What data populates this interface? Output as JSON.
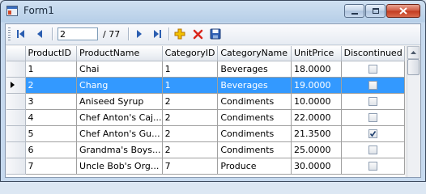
{
  "window": {
    "title": "Form1"
  },
  "navigator": {
    "position_value": "2",
    "count_label": "/ 77",
    "buttons": {
      "move_first": "first-record-icon",
      "move_previous": "previous-record-icon",
      "move_next": "next-record-icon",
      "move_last": "last-record-icon",
      "add_new": "add-icon",
      "delete": "delete-icon",
      "save": "save-icon"
    }
  },
  "grid": {
    "columns": [
      "ProductID",
      "ProductName",
      "CategoryID",
      "CategoryName",
      "UnitPrice",
      "Discontinued"
    ],
    "selected_row_index": 1,
    "rows": [
      {
        "cells": [
          "1",
          "Chai",
          "1",
          "Beverages",
          "18.0000"
        ],
        "discontinued": false
      },
      {
        "cells": [
          "2",
          "Chang",
          "1",
          "Beverages",
          "19.0000"
        ],
        "discontinued": false
      },
      {
        "cells": [
          "3",
          "Aniseed Syrup",
          "2",
          "Condiments",
          "10.0000"
        ],
        "discontinued": false
      },
      {
        "cells": [
          "4",
          "Chef Anton's Caj...",
          "2",
          "Condiments",
          "22.0000"
        ],
        "discontinued": false
      },
      {
        "cells": [
          "5",
          "Chef Anton's Gu...",
          "2",
          "Condiments",
          "21.3500"
        ],
        "discontinued": true
      },
      {
        "cells": [
          "6",
          "Grandma's Boys...",
          "2",
          "Condiments",
          "25.0000"
        ],
        "discontinued": false
      },
      {
        "cells": [
          "7",
          "Uncle Bob's Org...",
          "7",
          "Produce",
          "30.0000"
        ],
        "discontinued": false
      }
    ]
  },
  "colors": {
    "selection": "#3399ff",
    "navigator_arrow": "#2a5db0",
    "add": "#e8a000",
    "delete": "#d9261c"
  }
}
